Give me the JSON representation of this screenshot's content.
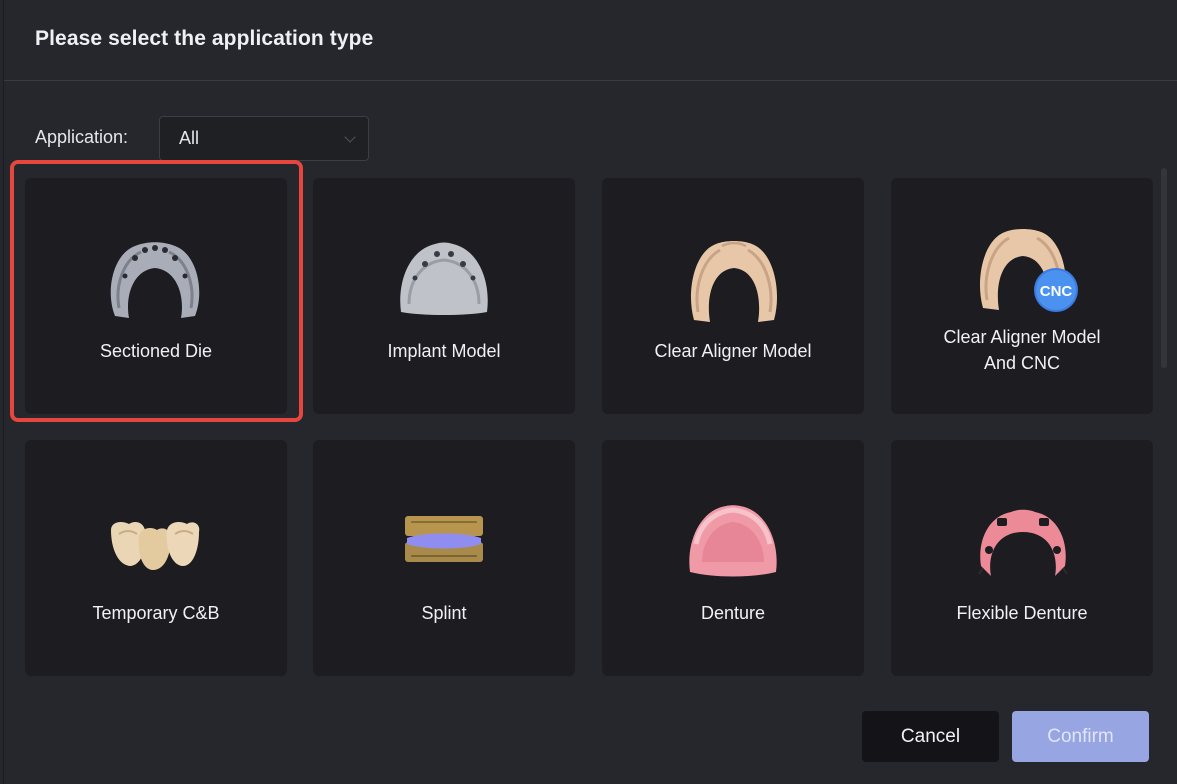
{
  "dialog": {
    "title": "Please select the application type"
  },
  "filter": {
    "label": "Application:",
    "value": "All"
  },
  "cards": [
    {
      "label": "Sectioned Die",
      "icon": "sectioned-die-icon"
    },
    {
      "label": "Implant Model",
      "icon": "implant-model-icon"
    },
    {
      "label": "Clear Aligner Model",
      "icon": "clear-aligner-model-icon"
    },
    {
      "label_line1": "Clear Aligner Model",
      "label_line2": "And CNC",
      "icon": "clear-aligner-cnc-icon",
      "badge": "CNC"
    },
    {
      "label": "Temporary C&B",
      "icon": "temporary-crown-bridge-icon"
    },
    {
      "label": "Splint",
      "icon": "splint-icon"
    },
    {
      "label": "Denture",
      "icon": "denture-icon"
    },
    {
      "label": "Flexible Denture",
      "icon": "flexible-denture-icon"
    }
  ],
  "selected_card": "Sectioned Die",
  "buttons": {
    "cancel": "Cancel",
    "confirm": "Confirm"
  },
  "colors": {
    "selection": "#e5473f",
    "confirm": "#98a5e3",
    "card_bg": "#1c1c21",
    "dialog_bg": "#26272c"
  }
}
